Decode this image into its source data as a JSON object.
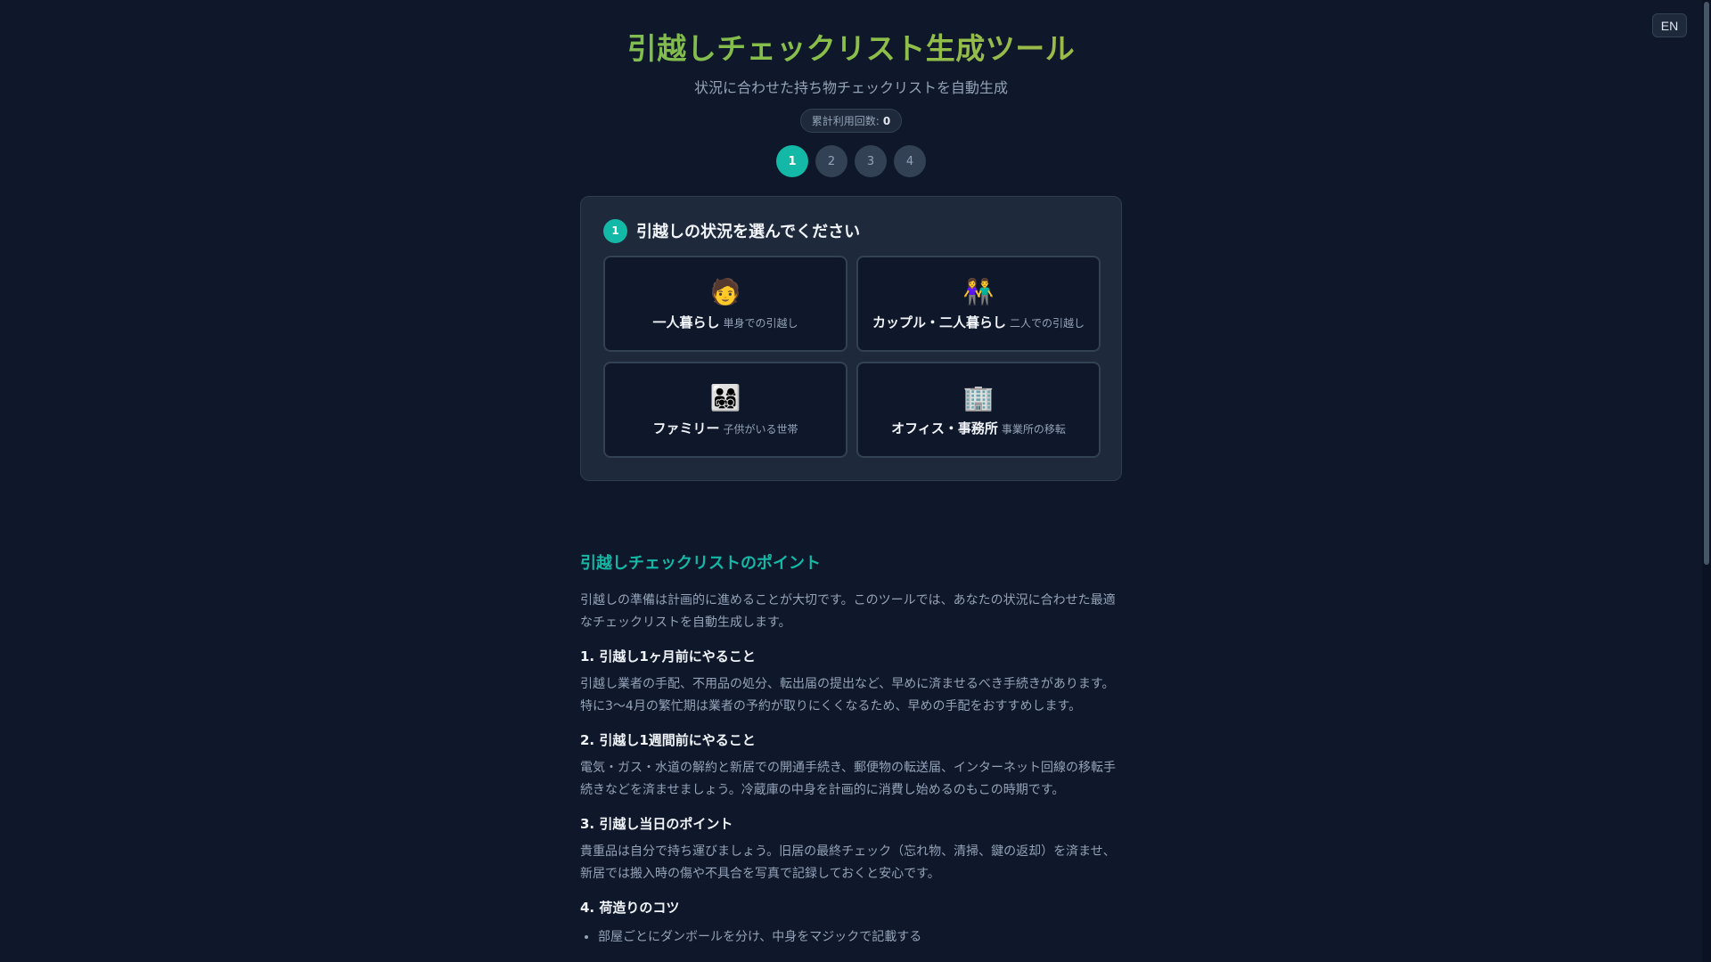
{
  "language_toggle": "EN",
  "header": {
    "title": "引越しチェックリスト生成ツール",
    "subtitle": "状況に合わせた持ち物チェックリストを自動生成",
    "counter_label": "累計利用回数:",
    "counter_value": "0"
  },
  "steps": [
    "1",
    "2",
    "3",
    "4"
  ],
  "active_step": 1,
  "question": {
    "number": "1",
    "label": "引越しの状況を選んでください"
  },
  "options": [
    {
      "emoji": "🧑",
      "title": "一人暮らし",
      "desc": "単身での引越し"
    },
    {
      "emoji": "👫",
      "title": "カップル・二人暮らし",
      "desc": "二人での引越し"
    },
    {
      "emoji": "👨‍👩‍👧‍👦",
      "title": "ファミリー",
      "desc": "子供がいる世帯"
    },
    {
      "emoji": "🏢",
      "title": "オフィス・事務所",
      "desc": "事業所の移転"
    }
  ],
  "article": {
    "heading": "引越しチェックリストのポイント",
    "intro": "引越しの準備は計画的に進めることが大切です。このツールでは、あなたの状況に合わせた最適なチェックリストを自動生成します。",
    "sections": [
      {
        "title": "1. 引越し1ヶ月前にやること",
        "body": "引越し業者の手配、不用品の処分、転出届の提出など、早めに済ませるべき手続きがあります。特に3〜4月の繁忙期は業者の予約が取りにくくなるため、早めの手配をおすすめします。"
      },
      {
        "title": "2. 引越し1週間前にやること",
        "body": "電気・ガス・水道の解約と新居での開通手続き、郵便物の転送届、インターネット回線の移転手続きなどを済ませましょう。冷蔵庫の中身を計画的に消費し始めるのもこの時期です。"
      },
      {
        "title": "3. 引越し当日のポイント",
        "body": "貴重品は自分で持ち運びましょう。旧居の最終チェック（忘れ物、清掃、鍵の返却）を済ませ、新居では搬入時の傷や不具合を写真で記録しておくと安心です。"
      },
      {
        "title": "4. 荷造りのコツ",
        "body": ""
      }
    ],
    "tips": [
      "部屋ごとにダンボールを分け、中身をマジックで記載する"
    ]
  }
}
